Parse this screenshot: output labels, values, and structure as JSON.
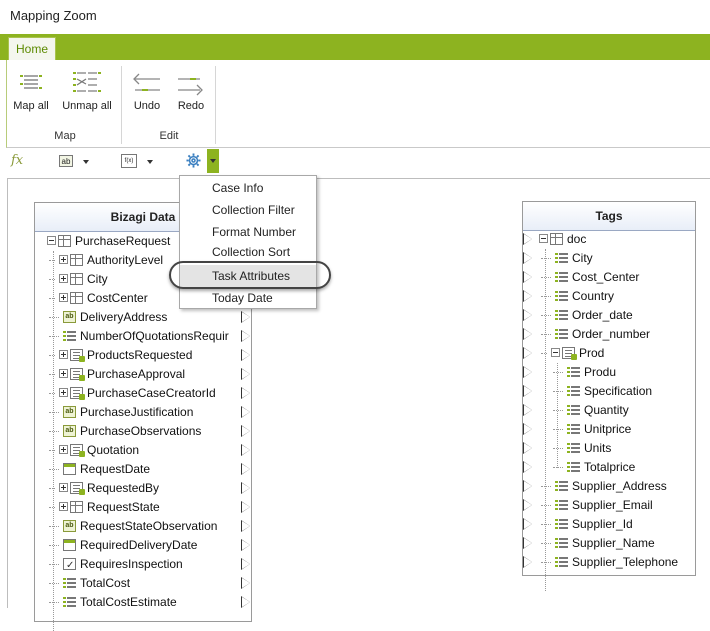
{
  "window": {
    "title": "Mapping Zoom"
  },
  "ribbon": {
    "tabs": [
      {
        "label": "Home"
      }
    ],
    "groups": [
      {
        "label": "Map",
        "buttons": [
          {
            "label": "Map all",
            "icon": "map-all-icon"
          },
          {
            "label": "Unmap all",
            "icon": "unmap-all-icon"
          }
        ]
      },
      {
        "label": "Edit",
        "buttons": [
          {
            "label": "Undo",
            "icon": "undo-icon"
          },
          {
            "label": "Redo",
            "icon": "redo-icon"
          }
        ]
      }
    ]
  },
  "formula_bar": {
    "fx_label": "fx",
    "text_function_label": "ab",
    "date_function_label": "f(x)",
    "settings_icon": "gear-icon"
  },
  "dropdown_menu": {
    "items": [
      {
        "label": "Case Info"
      },
      {
        "label": "Collection Filter"
      },
      {
        "label": "Format Number"
      },
      {
        "label": "Collection Sort"
      },
      {
        "label": "Task Attributes",
        "highlighted": true
      },
      {
        "label": "Today Date"
      }
    ]
  },
  "left_panel": {
    "title": "Bizagi Data",
    "rows": [
      {
        "label": "PurchaseRequest",
        "icon": "table-icon",
        "expander": "minus",
        "level": 0
      },
      {
        "label": "AuthorityLevel",
        "icon": "table-icon",
        "expander": "plus",
        "level": 1
      },
      {
        "label": "City",
        "icon": "table-icon",
        "expander": "plus",
        "level": 1
      },
      {
        "label": "CostCenter",
        "icon": "table-icon",
        "expander": "plus",
        "level": 1
      },
      {
        "label": "DeliveryAddress",
        "icon": "text-field-icon",
        "expander": "",
        "level": 1
      },
      {
        "label": "NumberOfQuotationsRequir",
        "icon": "number-field-icon",
        "expander": "",
        "level": 1
      },
      {
        "label": "ProductsRequested",
        "icon": "collection-icon",
        "expander": "plus",
        "level": 1
      },
      {
        "label": "PurchaseApproval",
        "icon": "collection-icon",
        "expander": "plus",
        "level": 1
      },
      {
        "label": "PurchaseCaseCreatorId",
        "icon": "entity-icon",
        "expander": "plus",
        "level": 1
      },
      {
        "label": "PurchaseJustification",
        "icon": "text-field-icon",
        "expander": "",
        "level": 1
      },
      {
        "label": "PurchaseObservations",
        "icon": "text-field-icon",
        "expander": "",
        "level": 1
      },
      {
        "label": "Quotation",
        "icon": "collection-icon",
        "expander": "plus",
        "level": 1
      },
      {
        "label": "RequestDate",
        "icon": "date-icon",
        "expander": "",
        "level": 1
      },
      {
        "label": "RequestedBy",
        "icon": "entity-icon",
        "expander": "plus",
        "level": 1
      },
      {
        "label": "RequestState",
        "icon": "table-icon",
        "expander": "plus",
        "level": 1
      },
      {
        "label": "RequestStateObservation",
        "icon": "text-field-icon",
        "expander": "",
        "level": 1
      },
      {
        "label": "RequiredDeliveryDate",
        "icon": "date-icon",
        "expander": "",
        "level": 1
      },
      {
        "label": "RequiresInspection",
        "icon": "boolean-icon",
        "expander": "",
        "level": 1
      },
      {
        "label": "TotalCost",
        "icon": "number-field-icon",
        "expander": "",
        "level": 1
      },
      {
        "label": "TotalCostEstimate",
        "icon": "number-field-icon",
        "expander": "",
        "level": 1
      }
    ]
  },
  "right_panel": {
    "title": "Tags",
    "rows": [
      {
        "label": "doc",
        "icon": "table-icon",
        "expander": "minus",
        "level": 0
      },
      {
        "label": "City",
        "icon": "number-field-icon",
        "expander": "",
        "level": 1
      },
      {
        "label": "Cost_Center",
        "icon": "number-field-icon",
        "expander": "",
        "level": 1
      },
      {
        "label": "Country",
        "icon": "number-field-icon",
        "expander": "",
        "level": 1
      },
      {
        "label": "Order_date",
        "icon": "number-field-icon",
        "expander": "",
        "level": 1
      },
      {
        "label": "Order_number",
        "icon": "number-field-icon",
        "expander": "",
        "level": 1
      },
      {
        "label": "Prod",
        "icon": "collection-icon",
        "expander": "minus",
        "level": 1
      },
      {
        "label": "Produ",
        "icon": "number-field-icon",
        "expander": "",
        "level": 2
      },
      {
        "label": "Specification",
        "icon": "number-field-icon",
        "expander": "",
        "level": 2
      },
      {
        "label": "Quantity",
        "icon": "number-field-icon",
        "expander": "",
        "level": 2
      },
      {
        "label": "Unitprice",
        "icon": "number-field-icon",
        "expander": "",
        "level": 2
      },
      {
        "label": "Units",
        "icon": "number-field-icon",
        "expander": "",
        "level": 2
      },
      {
        "label": "Totalprice",
        "icon": "number-field-icon",
        "expander": "",
        "level": 2
      },
      {
        "label": "Supplier_Address",
        "icon": "number-field-icon",
        "expander": "",
        "level": 1
      },
      {
        "label": "Supplier_Email",
        "icon": "number-field-icon",
        "expander": "",
        "level": 1
      },
      {
        "label": "Supplier_Id",
        "icon": "number-field-icon",
        "expander": "",
        "level": 1
      },
      {
        "label": "Supplier_Name",
        "icon": "number-field-icon",
        "expander": "",
        "level": 1
      },
      {
        "label": "Supplier_Telephone",
        "icon": "number-field-icon",
        "expander": "",
        "level": 1
      }
    ]
  },
  "colors": {
    "accent": "#8db320",
    "panel_header": "#e8eef8"
  }
}
